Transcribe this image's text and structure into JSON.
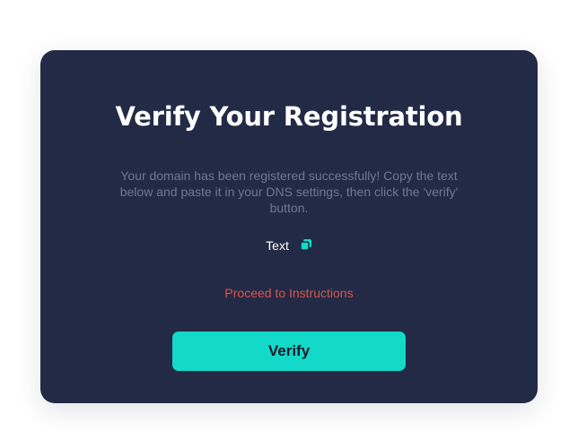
{
  "card": {
    "title": "Verify Your Registration",
    "description": "Your domain has been registered successfully! Copy the text below and paste it in your DNS settings, then click the 'verify' button.",
    "copy_text": "Text",
    "copy_icon": "copy-icon",
    "instructions_link": "Proceed to Instructions",
    "verify_label": "Verify"
  },
  "colors": {
    "card_background": "#222a45",
    "accent": "#12d9c8",
    "link": "#d9544f",
    "muted_text": "#6f7894"
  }
}
